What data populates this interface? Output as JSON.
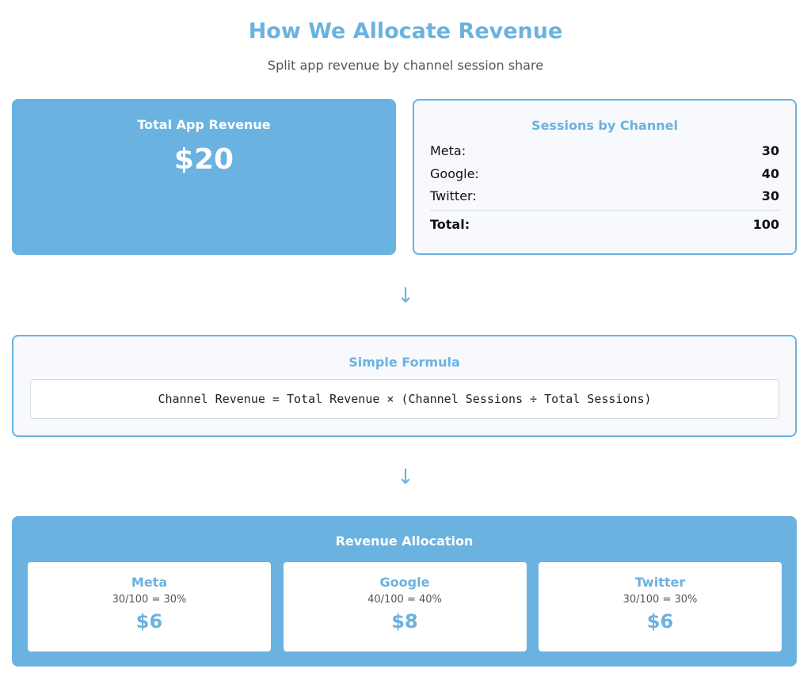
{
  "header": {
    "title": "How We Allocate Revenue",
    "subtitle": "Split app revenue by channel session share"
  },
  "total_revenue": {
    "label": "Total App Revenue",
    "value": "$20"
  },
  "sessions": {
    "title": "Sessions by Channel",
    "rows": [
      {
        "channel": "Meta:",
        "value": "30"
      },
      {
        "channel": "Google:",
        "value": "40"
      },
      {
        "channel": "Twitter:",
        "value": "30"
      }
    ],
    "total_label": "Total:",
    "total_value": "100"
  },
  "arrow_glyph": "↓",
  "formula": {
    "title": "Simple Formula",
    "text": "Channel Revenue = Total Revenue × (Channel Sessions ÷ Total Sessions)"
  },
  "allocation": {
    "title": "Revenue Allocation",
    "items": [
      {
        "name": "Meta",
        "calc": "30/100 = 30%",
        "amount": "$6"
      },
      {
        "name": "Google",
        "calc": "40/100 = 40%",
        "amount": "$8"
      },
      {
        "name": "Twitter",
        "calc": "30/100 = 30%",
        "amount": "$6"
      }
    ]
  },
  "colors": {
    "accent": "#6ab2e0",
    "panel_bg": "#f7f9fd"
  }
}
